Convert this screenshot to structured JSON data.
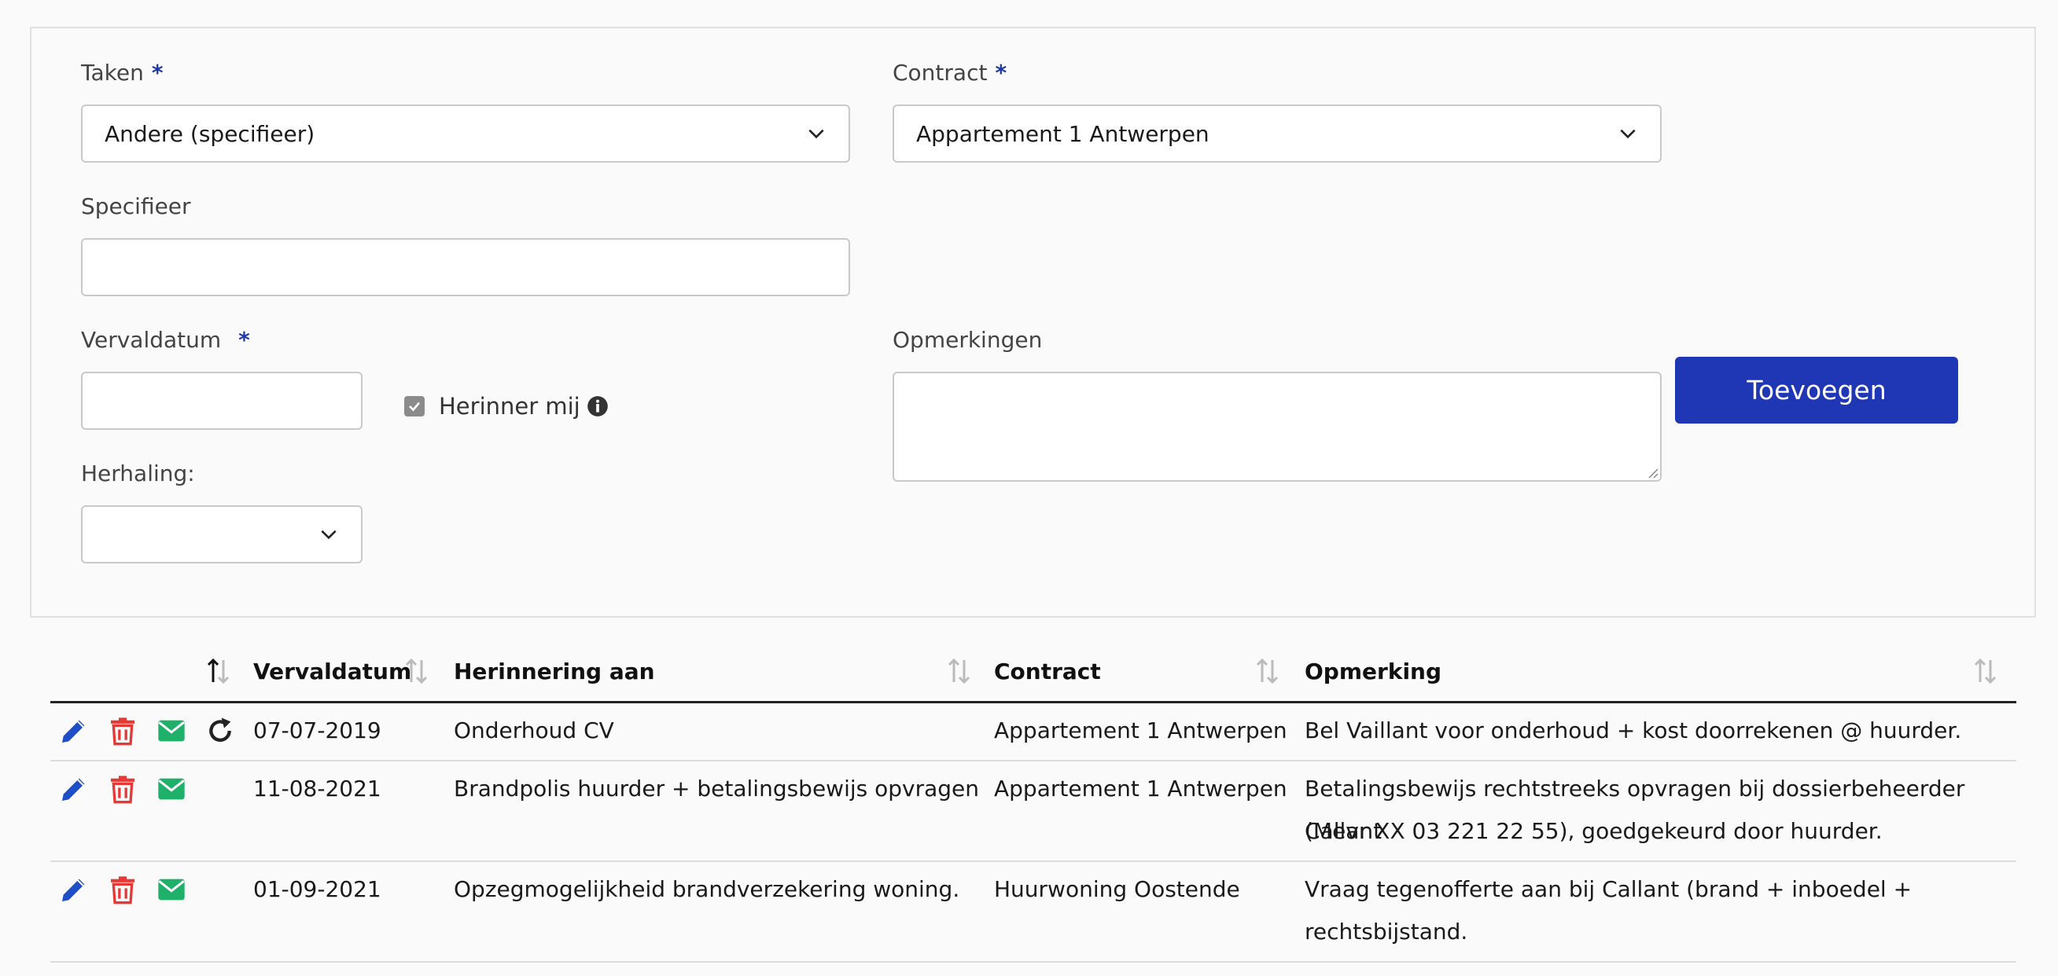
{
  "form": {
    "taken": {
      "label": "Taken",
      "required": "*",
      "value": "Andere (specifieer)"
    },
    "contract": {
      "label": "Contract",
      "required": "*",
      "value": "Appartement 1 Antwerpen"
    },
    "specifieer": {
      "label": "Specifieer",
      "value": ""
    },
    "vervaldatum": {
      "label": "Vervaldatum",
      "required": "*",
      "value": ""
    },
    "herinner": {
      "label": "Herinner mij",
      "checked": true
    },
    "herhaling": {
      "label": "Herhaling:",
      "value": ""
    },
    "opmerkingen": {
      "label": "Opmerkingen",
      "value": ""
    },
    "submit_label": "Toevoegen"
  },
  "table": {
    "columns": [
      "Vervaldatum",
      "Herinnering aan",
      "Contract",
      "Opmerking"
    ],
    "rows": [
      {
        "vervaldatum": "07-07-2019",
        "herinnering": "Onderhoud CV",
        "contract": "Appartement 1 Antwerpen",
        "opmerking_line1": "Bel Vaillant voor onderhoud + kost doorrekenen @ huurder.",
        "opmerking_line2": "",
        "recurring": true
      },
      {
        "vervaldatum": "11-08-2021",
        "herinnering": "Brandpolis huurder + betalingsbewijs opvragen",
        "contract": "Appartement 1 Antwerpen",
        "opmerking_line1": "Betalingsbewijs rechtstreeks opvragen bij dossierbeheerder Callant",
        "opmerking_line2": "(Mevr XX 03 221 22 55), goedgekeurd door huurder.",
        "recurring": false
      },
      {
        "vervaldatum": "01-09-2021",
        "herinnering": "Opzegmogelijkheid brandverzekering woning.",
        "contract": "Huurwoning Oostende",
        "opmerking_line1": "Vraag tegenofferte aan bij Callant (brand + inboedel +",
        "opmerking_line2": "rechtsbijstand.",
        "recurring": false
      }
    ]
  },
  "colors": {
    "accent": "#1f36b5",
    "edit": "#1f4fc8",
    "delete": "#e53935",
    "mail": "#1fb16a"
  },
  "icons": [
    "chevron-down-icon",
    "info-icon",
    "sort-icon",
    "pencil-icon",
    "trash-icon",
    "envelope-icon",
    "repeat-icon"
  ]
}
